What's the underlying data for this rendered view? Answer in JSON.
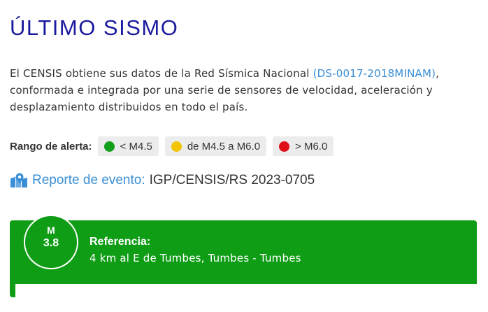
{
  "page": {
    "title": "ÚLTIMO SISMO"
  },
  "description": {
    "text_before": "El CENSIS obtiene sus datos de la Red Sísmica Nacional ",
    "link": "(DS-0017-2018MINAM)",
    "text_after": ", conformada e integrada por una serie de sensores de velocidad, aceleración y desplazamiento distribuidos en todo el país."
  },
  "alert_range": {
    "label": "Rango de alerta:",
    "items": [
      {
        "label": "< M4.5",
        "color": "#12a01a"
      },
      {
        "label": "de M4.5 a M6.0",
        "color": "#f2c500"
      },
      {
        "label": "> M6.0",
        "color": "#e0101a"
      }
    ]
  },
  "report": {
    "icon": "map-marker-icon",
    "label": "Reporte de evento:",
    "code": "IGP/CENSIS/RS 2023-0705"
  },
  "event": {
    "magnitude_label": "M",
    "magnitude_value": "3.8",
    "reference_title": "Referencia:",
    "reference_text": "4 km al E de Tumbes, Tumbes - Tumbes",
    "color": "#0f9d16"
  }
}
